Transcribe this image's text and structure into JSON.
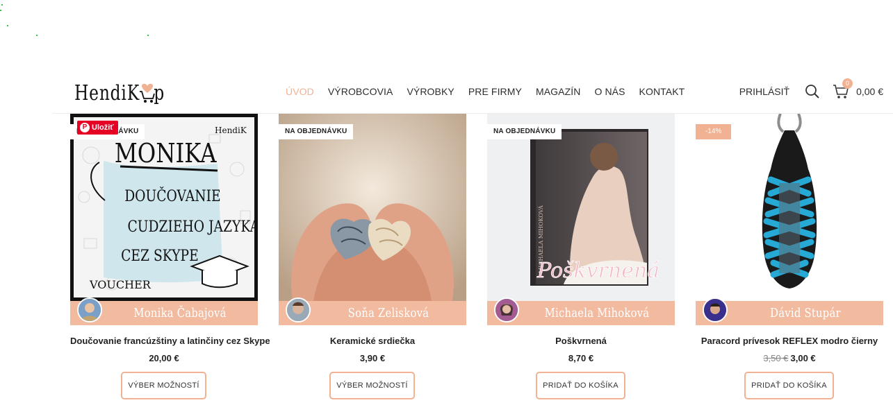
{
  "brand": {
    "logo_text": "HendiK",
    "logo_tail": "p"
  },
  "nav": {
    "items": [
      {
        "label": "ÚVOD",
        "active": true
      },
      {
        "label": "VÝROBCOVIA",
        "active": false
      },
      {
        "label": "VÝROBKY",
        "active": false
      },
      {
        "label": "PRE FIRMY",
        "active": false
      },
      {
        "label": "MAGAZÍN",
        "active": false
      },
      {
        "label": "O NÁS",
        "active": false
      },
      {
        "label": "KONTAKT",
        "active": false
      }
    ]
  },
  "header_actions": {
    "login_label": "PRIHLÁSIŤ",
    "cart_count": "0",
    "cart_total": "0,00 €"
  },
  "colors": {
    "accent": "#f0b293",
    "vendor_bar": "#f2bba0",
    "pinterest": "#e60023"
  },
  "products": [
    {
      "badge": "NA OBJEDNÁVKU",
      "pin_label": "Uložiť",
      "image_text": {
        "name": "MONIKA",
        "lines": [
          "DOUČOVANIE",
          "CUDZIEHO JAZYKA",
          "CEZ SKYPE"
        ],
        "voucher": "VOUCHER",
        "corner": "HendiK"
      },
      "vendor": "Monika Čabajová",
      "title": "Doučovanie francúzštiny a latinčiny cez Skype",
      "price": "20,00 €",
      "old_price": "",
      "button": "VÝBER MOŽNOSTÍ"
    },
    {
      "badge": "NA OBJEDNÁVKU",
      "vendor": "Soňa Zelisková",
      "title": "Keramické srdiečka",
      "price": "3,90 €",
      "old_price": "",
      "button": "VÝBER MOŽNOSTÍ"
    },
    {
      "badge": "NA OBJEDNÁVKU",
      "image_text": {
        "book_author": "MICHAELA MIHOKOVÁ",
        "book_title": "Poškvrnená"
      },
      "vendor": "Michaela Mihoková",
      "title": "Poškvrnená",
      "price": "8,70 €",
      "old_price": "",
      "button": "PRIDAŤ DO KOŠÍKA"
    },
    {
      "badge": "-14%",
      "vendor": "Dávid Stupár",
      "title": "Paracord prívesok REFLEX modro čierny",
      "price": "3,00 €",
      "old_price": "3,50 €",
      "button": "PRIDAŤ DO KOŠÍKA"
    }
  ]
}
